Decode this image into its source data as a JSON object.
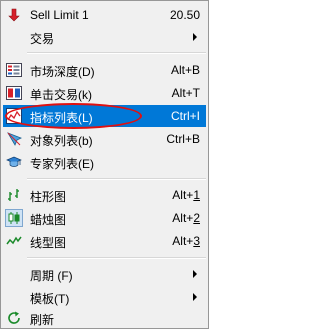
{
  "menu": {
    "item_sell_limit": {
      "label": "Sell Limit 1",
      "value": "20.50",
      "icon": "red-down-arrow-icon"
    },
    "item_trade": {
      "label": "交易"
    },
    "item_depth": {
      "label": "市场深度(D)",
      "shortcut": "Alt+B",
      "icon": "market-depth-icon"
    },
    "item_oneclick": {
      "label": "单击交易(k)",
      "shortcut": "Alt+T",
      "icon": "one-click-trading-icon"
    },
    "item_indicators": {
      "label": "指标列表(L)",
      "shortcut": "Ctrl+I",
      "icon": "indicators-list-icon"
    },
    "item_objects": {
      "label": "对象列表(b)",
      "shortcut": "Ctrl+B",
      "icon": "objects-list-icon"
    },
    "item_experts": {
      "label": "专家列表(E)",
      "icon": "expert-advisors-icon"
    },
    "item_bar_chart": {
      "label": "柱形图",
      "shortcut_prefix": "Alt+",
      "shortcut_digit": "1",
      "icon": "bar-chart-icon"
    },
    "item_candle_chart": {
      "label": "蜡烛图",
      "shortcut_prefix": "Alt+",
      "shortcut_digit": "2",
      "icon": "candlestick-chart-icon"
    },
    "item_line_chart": {
      "label": "线型图",
      "shortcut_prefix": "Alt+",
      "shortcut_digit": "3",
      "icon": "line-chart-icon"
    },
    "item_period": {
      "label": "周期 (F)"
    },
    "item_template": {
      "label": "模板(T)"
    },
    "item_refresh": {
      "label": "刷新",
      "icon": "refresh-icon"
    }
  },
  "colors": {
    "highlight": "#0078d7",
    "annotation": "#e01010"
  }
}
